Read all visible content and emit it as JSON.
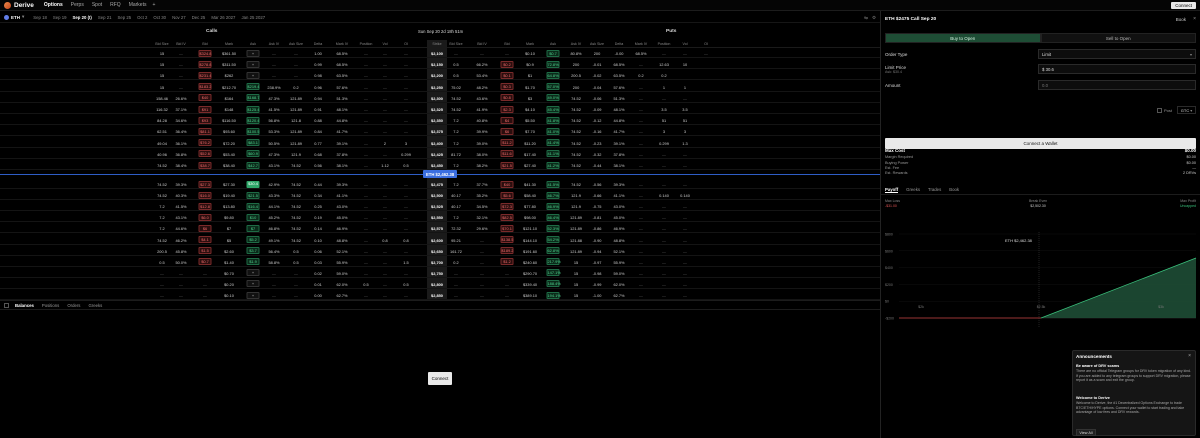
{
  "nav": {
    "brand": "Derive",
    "items": [
      "Options",
      "Perps",
      "Spot",
      "RFQ",
      "Markets"
    ],
    "more": "+",
    "connect": "Connect"
  },
  "datebar": {
    "asset": "ETH",
    "dates": [
      "Sep 18",
      "Sep 19",
      "Sep 20 (t)",
      "Sep 21",
      "Sep 25",
      "Oct 2",
      "Oct 30",
      "Nov 27",
      "Dec 25",
      "Mar 26 2027",
      "Jan 25 2027"
    ]
  },
  "board": {
    "calls_label": "Calls",
    "puts_label": "Puts",
    "expiry": "Sun Sep 20 2d 18h 51m",
    "columns": [
      "Bid Size",
      "Bid IV",
      "Bid",
      "Mark",
      "Ask",
      "Ask IV",
      "Ask Size",
      "Delta",
      "Mark IV",
      "Position",
      "Vol",
      "OI",
      "Strike",
      "Bid Size",
      "Bid IV",
      "Bid",
      "Mark",
      "Ask",
      "Ask IV",
      "Ask Size",
      "Delta",
      "Mark IV",
      "Position",
      "Vol",
      "OI"
    ],
    "spot_label": "ETH $2,462.38",
    "rows": [
      [
        "15",
        "—",
        "$324.8",
        "$361.50",
        "+",
        "—",
        "—",
        "1.00",
        "68.5%",
        "—",
        "—",
        "—",
        "$2,100",
        "—",
        "—",
        "—",
        "$0.10",
        "$0.7",
        "80.8%",
        "200",
        "-0.00",
        "68.5%",
        "—",
        "—",
        "—"
      ],
      [
        "15",
        "—",
        "$278.8",
        "$311.50",
        "+",
        "—",
        "—",
        "0.99",
        "68.5%",
        "—",
        "—",
        "—",
        "$2,150",
        "0.5",
        "66.2%",
        "$0.2",
        "$0.9",
        "72.8%",
        "200",
        "-0.01",
        "68.5%",
        "—",
        "12.63",
        "10"
      ],
      [
        "15",
        "—",
        "$231.4",
        "$262",
        "+",
        "—",
        "—",
        "0.98",
        "63.5%",
        "—",
        "—",
        "—",
        "$2,200",
        "0.5",
        "53.4%",
        "$0.1",
        "$1",
        "64.8%",
        "200.5",
        "-0.02",
        "63.5%",
        "0.2",
        "0.2"
      ],
      [
        "15",
        "—",
        "$183.2",
        "$212.70",
        "$219.4",
        "238.9%",
        "0.2",
        "0.96",
        "57.6%",
        "—",
        "—",
        "—",
        "$2,250",
        "75.02",
        "48.2%",
        "$0.3",
        "$1.70",
        "57.0%",
        "200",
        "-0.04",
        "57.6%",
        "—",
        "1",
        "1"
      ],
      [
        "158.46",
        "26.6%",
        "$40",
        "$164",
        "$168.7",
        "47.3%",
        "121.89",
        "0.94",
        "51.3%",
        "—",
        "—",
        "—",
        "$2,300",
        "74.52",
        "43.6%",
        "$0.8",
        "$3",
        "49.0%",
        "74.52",
        "-0.06",
        "51.3%",
        "—",
        "—",
        "—"
      ],
      [
        "116.32",
        "37.1%",
        "$91",
        "$148",
        "$125.4",
        "41.5%",
        "121.89",
        "0.91",
        "48.1%",
        "—",
        "—",
        "—",
        "$2,325",
        "74.52",
        "41.9%",
        "$2.3",
        "$4.10",
        "45.4%",
        "74.52",
        "-0.09",
        "48.1%",
        "—",
        "3.5",
        "3.5"
      ],
      [
        "84.28",
        "34.6%",
        "$93",
        "$116.50",
        "$120.4",
        "56.8%",
        "121.8",
        "0.88",
        "44.8%",
        "—",
        "—",
        "—",
        "$2,350",
        "7.2",
        "40.8%",
        "$4",
        "$5.50",
        "41.8%",
        "74.52",
        "-0.12",
        "44.8%",
        "—",
        "51",
        "51"
      ],
      [
        "62.51",
        "36.4%",
        "$81.1",
        "$93.60",
        "$100.5",
        "53.3%",
        "121.89",
        "0.84",
        "41.7%",
        "—",
        "—",
        "—",
        "$2,375",
        "7.2",
        "39.9%",
        "$6",
        "$7.70",
        "41.0%",
        "74.52",
        "-0.16",
        "41.7%",
        "—",
        "3",
        "3"
      ],
      [
        "49.04",
        "36.1%",
        "$76.2",
        "$72.20",
        "$83.1",
        "50.5%",
        "121.89",
        "0.77",
        "39.1%",
        "—",
        "2",
        "3",
        "$2,400",
        "7.2",
        "39.0%",
        "$11.2",
        "$11.20",
        "41.4%",
        "74.52",
        "-0.23",
        "39.1%",
        "—",
        "0.299",
        "1.3"
      ],
      [
        "40.96",
        "36.8%",
        "$52.6",
        "$53.40",
        "$60.9",
        "47.3%",
        "121.9",
        "0.68",
        "37.8%",
        "—",
        "—",
        "0.299",
        "$2,425",
        "81.72",
        "38.0%",
        "$11.6",
        "$17.40",
        "41.1%",
        "74.52",
        "-0.32",
        "37.8%",
        "—",
        "—",
        "—"
      ],
      [
        "74.52",
        "38.4%",
        "$38.7",
        "$38.40",
        "$42.7",
        "43.1%",
        "74.52",
        "0.56",
        "38.1%",
        "—",
        "1.12",
        "0.5",
        "$2,450",
        "7.2",
        "38.2%",
        "$21.5",
        "$27.40",
        "41.2%",
        "74.52",
        "-0.44",
        "38.1%",
        "—",
        "—",
        "—"
      ],
      [
        "74.52",
        "39.3%",
        "$27.3",
        "$27.30",
        "$30.4",
        "42.9%",
        "74.52",
        "0.44",
        "39.3%",
        "—",
        "—",
        "—",
        "$2,475",
        "7.2",
        "37.7%",
        "$40",
        "$41.30",
        "41.5%",
        "74.52",
        "-0.56",
        "39.3%",
        "—",
        "—",
        "—"
      ],
      [
        "74.52",
        "40.3%",
        "$16.0",
        "$19.40",
        "$21.5",
        "43.3%",
        "74.52",
        "0.34",
        "41.1%",
        "—",
        "—",
        "—",
        "$2,500",
        "40.17",
        "35.2%",
        "$5.6",
        "$58.40",
        "46.7%",
        "121.9",
        "-0.66",
        "41.1%",
        "—",
        "0.140",
        "0.140"
      ],
      [
        "7.2",
        "41.5%",
        "$12.8",
        "$13.80",
        "$16.4",
        "44.1%",
        "74.52",
        "0.25",
        "43.0%",
        "—",
        "—",
        "—",
        "$2,525",
        "40.17",
        "34.5%",
        "$72.3",
        "$77.80",
        "46.9%",
        "121.9",
        "-0.75",
        "43.0%",
        "—",
        "—",
        "—"
      ],
      [
        "7.2",
        "43.1%",
        "$6.0",
        "$9.80",
        "$10",
        "45.2%",
        "74.52",
        "0.19",
        "45.0%",
        "—",
        "—",
        "—",
        "$2,550",
        "7.2",
        "32.1%",
        "$82.5",
        "$98.00",
        "46.4%",
        "121.89",
        "-0.81",
        "45.0%",
        "—",
        "—",
        "—"
      ],
      [
        "7.2",
        "44.6%",
        "$6",
        "$7",
        "$7",
        "46.8%",
        "74.52",
        "0.14",
        "46.9%",
        "—",
        "—",
        "—",
        "$2,575",
        "72.32",
        "29.6%",
        "$70.1",
        "$121.10",
        "52.3%",
        "121.89",
        "-0.86",
        "46.9%",
        "—",
        "—",
        "—"
      ],
      [
        "74.52",
        "46.2%",
        "$4.1",
        "$5",
        "$5.2",
        "49.1%",
        "74.52",
        "0.10",
        "48.8%",
        "—",
        "0.8",
        "0.8",
        "$2,600",
        "95.21",
        "—",
        "$138.5",
        "$144.10",
        "54.2%",
        "121.88",
        "-0.90",
        "48.8%",
        "—",
        "—",
        "—"
      ],
      [
        "200.5",
        "45.8%",
        "$1.5",
        "$2.60",
        "$3.7",
        "56.4%",
        "0.5",
        "0.06",
        "52.1%",
        "—",
        "—",
        "—",
        "$2,650",
        "161.72",
        "—",
        "$189.2",
        "$191.60",
        "62.8%",
        "121.89",
        "-0.94",
        "52.1%",
        "—",
        "—",
        "—"
      ],
      [
        "0.5",
        "50.0%",
        "$0.7",
        "$1.40",
        "$1.9",
        "58.8%",
        "0.5",
        "0.03",
        "55.9%",
        "—",
        "—",
        "1.5",
        "$2,700",
        "0.2",
        "—",
        "$1.2",
        "$240.60",
        "217.9%",
        "15",
        "-0.97",
        "55.9%",
        "—",
        "—",
        "—"
      ],
      [
        "—",
        "—",
        "—",
        "$0.70",
        "+",
        "—",
        "—",
        "0.02",
        "59.0%",
        "—",
        "—",
        "—",
        "$2,750",
        "—",
        "—",
        "—",
        "$290.70",
        "147.1%",
        "15",
        "-0.98",
        "59.0%",
        "—",
        "—",
        "—"
      ],
      [
        "—",
        "—",
        "—",
        "$0.20",
        "+",
        "—",
        "—",
        "0.01",
        "62.0%",
        "0.5",
        "—",
        "0.5",
        "$2,800",
        "—",
        "—",
        "—",
        "$339.40",
        "188.4%",
        "15",
        "-0.99",
        "62.0%",
        "—",
        "—",
        "—"
      ],
      [
        "—",
        "—",
        "—",
        "$0.10",
        "+",
        "—",
        "—",
        "0.00",
        "62.7%",
        "—",
        "—",
        "—",
        "$2,850",
        "—",
        "—",
        "—",
        "$389.10",
        "194.1%",
        "15",
        "-1.00",
        "62.7%",
        "—",
        "—",
        "—"
      ]
    ]
  },
  "bottom": {
    "tabs": [
      "Balances",
      "Positions",
      "Orders",
      "Greeks"
    ],
    "connect": "Connect"
  },
  "order": {
    "title": "ETH $2475 Call Sep 20",
    "book": "Book",
    "buy": "Buy to Open",
    "sell": "Sell to Open",
    "order_type_label": "Order Type",
    "order_type_value": "Limit",
    "limit_label": "Limit Price",
    "limit_sub": "Ask: $30.4",
    "limit_value": "$ 30.6",
    "amount_label": "Amount",
    "amount_value": "0.0",
    "post": "Post",
    "tif": "GTC",
    "connect_wallet": "Connect a Wallet",
    "summary": [
      {
        "k": "Max Cost",
        "v": "$0.00",
        "bold": true
      },
      {
        "k": "Margin Required",
        "v": "$0.00"
      },
      {
        "k": "Buying Power",
        "v": "$0.00"
      },
      {
        "k": "Est. Fee",
        "v": "—"
      },
      {
        "k": "Est. Rewards",
        "v": "2 DRVs"
      }
    ],
    "chart_tabs": [
      "Payoff",
      "Greeks",
      "Trades",
      "Book"
    ],
    "max_loss_label": "Max Loss",
    "max_loss_value": "-$31.00",
    "break_even_label": "Break Even",
    "break_even_value": "$2,502.30",
    "max_profit_label": "Max Profit",
    "max_profit_value": "Uncapped",
    "spot_marker": "ETH $2,462.38",
    "y_ticks": [
      "$800",
      "$600",
      "$400",
      "$200",
      "$0",
      "-$200"
    ],
    "x_ticks": [
      "$2k",
      "$2.5k",
      "$3k"
    ]
  },
  "announcements": {
    "title": "Announcements",
    "items": [
      {
        "h": "Be aware of DRV scams",
        "p": "There are no official Telegram groups for DRV token migration of any kind. If you are added to any telegram groups to support DRV migration, please report it as a scam and exit the group."
      },
      {
        "h": "Welcome to Derive",
        "p": "Welcome to Derive, the #1 Decentralized Options Exchange to trade BTC/ETH/HYPE options. Connect your wallet to start trading and take advantage of low fees and DRV rewards."
      }
    ],
    "view_all": "View All"
  },
  "colors": {
    "bid": "#e05555",
    "ask": "#39c07b",
    "accent": "#3a6ee0",
    "buy_bg": "#1e4d35"
  }
}
